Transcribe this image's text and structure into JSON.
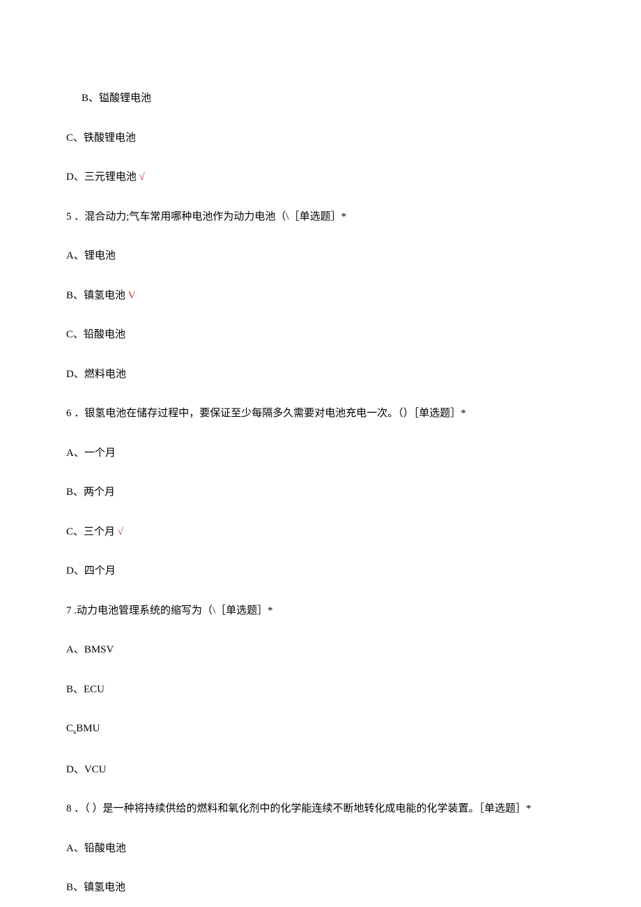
{
  "lines": {
    "l1": "B、镒酸锂电池",
    "l2": "C、铁酸锂电池",
    "l3a": "D、三元锂电池",
    "l3b": " √",
    "l4": "5 ．混合动力;气车常用哪种电池作为动力电池（\\［单选题］*",
    "l5": "A、锂电池",
    "l6a": "B、镇氢电池",
    "l6b": " V",
    "l7": "C、铅酸电池",
    "l8": "D、燃料电池",
    "l9": "6 ．银氢电池在储存过程中，要保证至少每隔多久需要对电池充电一次。（）［单选题］*",
    "l10": "A、一个月",
    "l11": "B、两个月",
    "l12a": "C、三个月",
    "l12b": " √",
    "l13": "D、四个月",
    "l14": "7  .动力电池管理系统的缩写为（\\［单选题］*",
    "l15": "A、BMSV",
    "l16": "B、ECU",
    "l17a": "C",
    "l17b": "s",
    "l17c": "BMU",
    "l18": "D、VCU",
    "l19": "8 ．（ ）是一种将持续供给的燃料和氧化剂中的化学能连续不断地转化成电能的化学装置。［单选题］*",
    "l20": "A、铅酸电池",
    "l21": "B、镇氢电池"
  }
}
